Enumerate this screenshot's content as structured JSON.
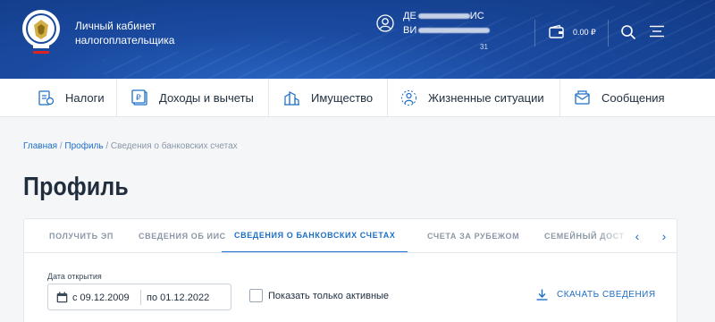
{
  "header": {
    "cabinet_title_line1": "Личный кабинет",
    "cabinet_title_line2": "налогоплательщика",
    "user_line1_visible": "ДЕ",
    "user_line1_end": "ИС",
    "user_line2_visible": "ВИ",
    "user_suffix": "31",
    "balance": "0.00 ₽",
    "colors": {
      "background": "#1a4aa0",
      "text": "#ffffff"
    }
  },
  "nav": {
    "items": [
      {
        "label": "Налоги",
        "icon": "taxes-icon"
      },
      {
        "label": "Доходы и вычеты",
        "icon": "income-icon"
      },
      {
        "label": "Имущество",
        "icon": "property-icon"
      },
      {
        "label": "Жизненные ситуации",
        "icon": "life-situations-icon"
      },
      {
        "label": "Сообщения",
        "icon": "messages-icon"
      }
    ]
  },
  "breadcrumb": {
    "home": "Главная",
    "sep": " / ",
    "profile": "Профиль",
    "current": "Сведения о банковских счетах"
  },
  "page_title": "Профиль",
  "tabs": [
    {
      "label": "ПОЛУЧИТЬ ЭП",
      "active": false
    },
    {
      "label": "СВЕДЕНИЯ ОБ ИИС",
      "active": false
    },
    {
      "label": "СВЕДЕНИЯ О БАНКОВСКИХ СЧЕТАХ",
      "active": true
    },
    {
      "label": "СЧЕТА ЗА РУБЕЖОМ",
      "active": false
    },
    {
      "label": "СЕМЕЙНЫЙ ДОСТ",
      "active": false
    }
  ],
  "tab_arrows": {
    "prev": "‹",
    "next": "›"
  },
  "filters": {
    "date_label": "Дата открытия",
    "date_from": "с 09.12.2009",
    "date_to": "по 01.12.2022",
    "only_active_label": "Показать только активные",
    "only_active_checked": false
  },
  "download_label": "СКАЧАТЬ СВЕДЕНИЯ",
  "accent_color": "#1f6fc6"
}
